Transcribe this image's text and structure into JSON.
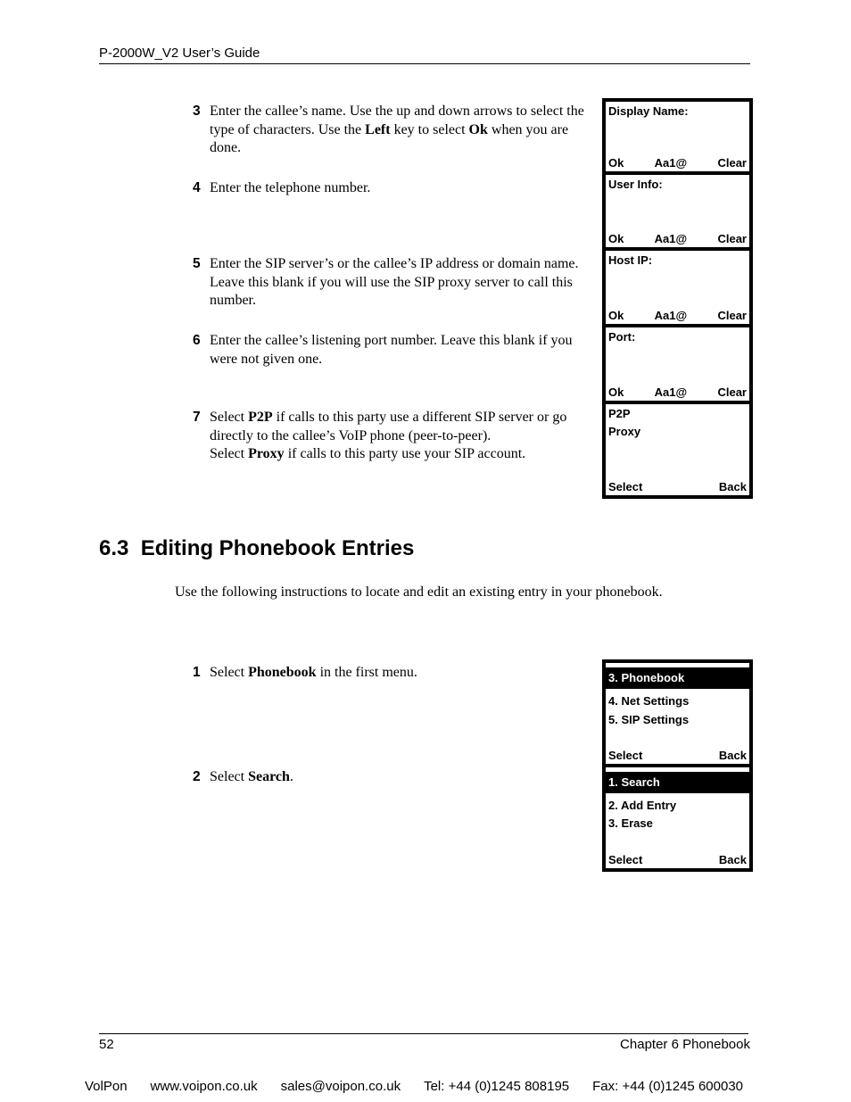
{
  "header": {
    "title": "P-2000W_V2 User’s Guide"
  },
  "steps_top": [
    {
      "num": "3",
      "parts": [
        {
          "t": "Enter the callee’s name. Use the up and down arrows to select the type of characters. Use the "
        },
        {
          "t": "Left",
          "b": true
        },
        {
          "t": " key to select "
        },
        {
          "t": "Ok",
          "b": true
        },
        {
          "t": " when you are done."
        }
      ]
    },
    {
      "num": "4",
      "parts": [
        {
          "t": "Enter the telephone number."
        }
      ]
    },
    {
      "num": "5",
      "parts": [
        {
          "t": "Enter the SIP server’s or the callee’s IP address or domain name. Leave this blank if you will use the SIP proxy server to call this number."
        }
      ]
    },
    {
      "num": "6",
      "parts": [
        {
          "t": "Enter the callee’s listening port number. Leave this blank if you were not given one."
        }
      ]
    },
    {
      "num": "7",
      "parts": [
        {
          "t": "Select "
        },
        {
          "t": "P2P",
          "b": true
        },
        {
          "t": " if calls to this party use a different SIP server or go directly to the callee’s VoIP phone (peer-to-peer)."
        },
        {
          "br": true
        },
        {
          "t": "Select "
        },
        {
          "t": "Proxy",
          "b": true
        },
        {
          "t": " if calls to this party use your SIP account."
        }
      ]
    }
  ],
  "screens_top": [
    {
      "title": "Display Name:",
      "lines": [],
      "softkeys": [
        "Ok",
        "Aa1@",
        "Clear"
      ]
    },
    {
      "title": "User Info:",
      "lines": [],
      "softkeys": [
        "Ok",
        "Aa1@",
        "Clear"
      ]
    },
    {
      "title": "Host IP:",
      "lines": [],
      "softkeys": [
        "Ok",
        "Aa1@",
        "Clear"
      ]
    },
    {
      "title": "Port:",
      "lines": [],
      "softkeys": [
        "Ok",
        "Aa1@",
        "Clear"
      ]
    },
    {
      "title": "P2P",
      "lines": [
        "Proxy"
      ],
      "softkeys": [
        "Select",
        "Back"
      ]
    }
  ],
  "section": {
    "title": "6.3  Editing Phonebook Entries",
    "intro": "Use the following instructions to locate and edit an existing entry in your phonebook."
  },
  "steps_bottom": [
    {
      "num": "1",
      "parts": [
        {
          "t": "Select "
        },
        {
          "t": "Phonebook",
          "b": true
        },
        {
          "t": " in the first menu."
        }
      ]
    },
    {
      "num": "2",
      "parts": [
        {
          "t": "Select "
        },
        {
          "t": "Search",
          "b": true
        },
        {
          "t": "."
        }
      ]
    }
  ],
  "screens_bottom": [
    {
      "highlight": "3. Phonebook",
      "lines": [
        "4. Net Settings",
        "5. SIP Settings"
      ],
      "softkeys": [
        "Select",
        "Back"
      ]
    },
    {
      "highlight": "1. Search",
      "lines": [
        "2. Add Entry",
        "3. Erase"
      ],
      "softkeys": [
        "Select",
        "Back"
      ]
    }
  ],
  "footer": {
    "page_number": "52",
    "chapter": "Chapter 6 Phonebook",
    "contact": [
      "VolPon",
      "www.voipon.co.uk",
      "sales@voipon.co.uk",
      "Tel: +44 (0)1245 808195",
      "Fax: +44 (0)1245 600030"
    ]
  }
}
